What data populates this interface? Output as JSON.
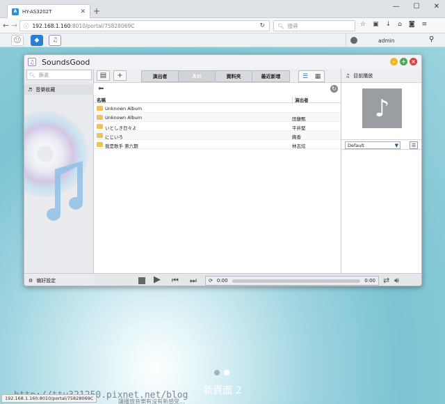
{
  "browser": {
    "tab_title": "HY-AS3202T",
    "url_host": "192.168.1.160",
    "url_rest": ":8010/portal/75828069C",
    "search_placeholder": "搜尋"
  },
  "portal": {
    "username": "admin"
  },
  "app": {
    "title": "SoundsGood",
    "search_placeholder": "篩選",
    "sidebar_item": "音樂收藏",
    "settings_label": "偏好設定",
    "tabs": [
      "演出者",
      "專輯",
      "資料夾",
      "最近新增"
    ],
    "active_tab": 1,
    "columns": {
      "name": "名稱",
      "artist": "演出者"
    },
    "rows": [
      {
        "name": "Unknown Album",
        "artist": ""
      },
      {
        "name": "Unknown Album",
        "artist": "田馥甄"
      },
      {
        "name": "いとしき日々よ",
        "artist": "平井堅"
      },
      {
        "name": "にじいろ",
        "artist": "絢香"
      },
      {
        "name": "我是歌手 第六期",
        "artist": "林志炫"
      }
    ],
    "now_playing_label": "目前播放",
    "playlist_select": "Default",
    "player": {
      "elapsed": "0:00",
      "total": "0:00"
    }
  },
  "desktop": {
    "page_label": "新頁面 2",
    "status_url": "192.168.1.160:8010/portal/75828069C",
    "watermark": "http://tty321250.pixnet.net/blog",
    "bottom_text": "讓播放音樂有沒有新感受..."
  }
}
